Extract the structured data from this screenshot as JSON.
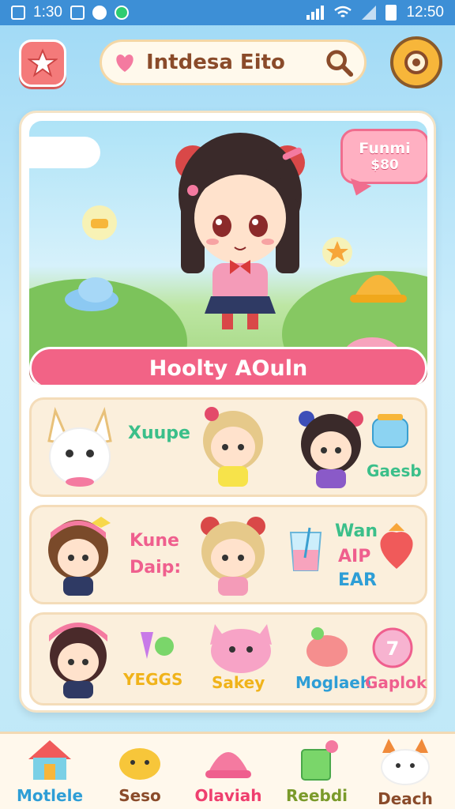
{
  "status_bar": {
    "time_left": "1:30",
    "time_right": "12:50"
  },
  "header": {
    "search_title": "Intdesa Eito"
  },
  "hero": {
    "bubble_title": "Funmi",
    "bubble_price": "$80",
    "banner_text": "Hoolty AOuln"
  },
  "rows": [
    {
      "labels": [
        "Xuupe",
        "Gaesb"
      ]
    },
    {
      "labels": [
        "Kune",
        "Daip:",
        "Wan",
        "AIP",
        "EAR"
      ]
    },
    {
      "labels": [
        "YEGGS",
        "Sakey",
        "Moglaeh",
        "Gaplok"
      ]
    }
  ],
  "bottom_nav": [
    {
      "label": "Motlele",
      "icon": "house-icon",
      "color": "#2e9ed6"
    },
    {
      "label": "Seso",
      "icon": "chick-icon",
      "color": "#8a4b2a"
    },
    {
      "label": "Olaviah",
      "icon": "bell-icon",
      "color": "#ef3f6e"
    },
    {
      "label": "Reebdi",
      "icon": "gift-bag-icon",
      "color": "#7a9a2a"
    },
    {
      "label": "Deach",
      "icon": "creature-icon",
      "color": "#8a4b2a"
    }
  ],
  "colors": {
    "accent_pink": "#f26386",
    "accent_yellow": "#f7b63a",
    "sky": "#9fd9f5"
  }
}
